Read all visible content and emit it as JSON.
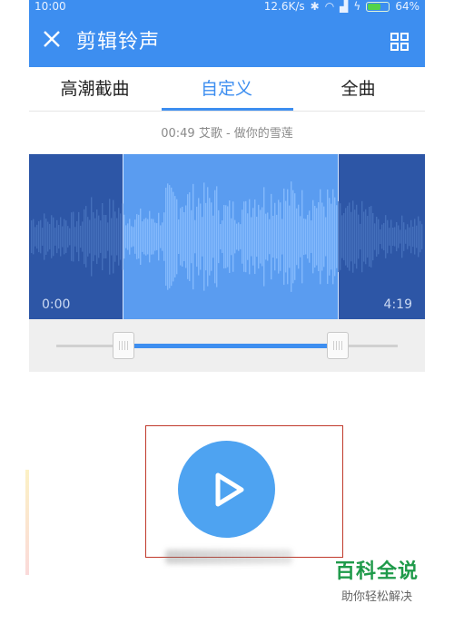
{
  "status_bar": {
    "time": "10:00",
    "speed": "12.6K/s",
    "battery": "64%",
    "battery_level": 0.64
  },
  "app_bar": {
    "title": "剪辑铃声",
    "close_icon": "close-icon",
    "grid_icon": "grid-icon"
  },
  "tabs": [
    {
      "label": "高潮截曲",
      "active": false
    },
    {
      "label": "自定义",
      "active": true
    },
    {
      "label": "全曲",
      "active": false
    }
  ],
  "song": {
    "info": "00:49  艾歌 - 做你的雪莲"
  },
  "waveform": {
    "start_time": "0:00",
    "end_time": "4:19"
  },
  "player": {
    "play_icon": "play-icon"
  },
  "watermark": {
    "title": "百科全说",
    "subtitle": "助你轻松解决"
  },
  "colors": {
    "accent": "#3d8ef0",
    "wave_bg": "#2d56a6",
    "selection": "#5a9cf0",
    "play_button": "#4ea3f1",
    "highlight_box": "#c0392b"
  }
}
